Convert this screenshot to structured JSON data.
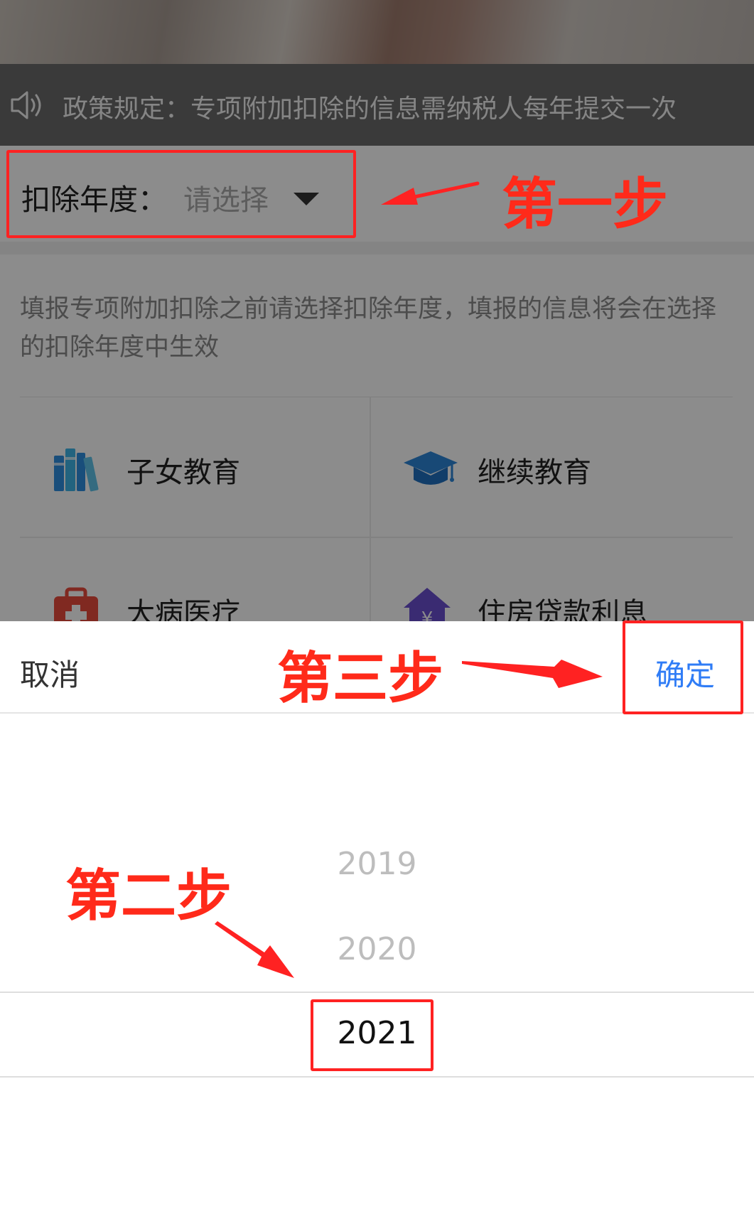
{
  "notice": {
    "text": "政策规定：专项附加扣除的信息需纳税人每年提交一次",
    "icon": "speaker-icon"
  },
  "year_select": {
    "label": "扣除年度：",
    "placeholder": "请选择"
  },
  "description": "填报专项附加扣除之前请选择扣除年度，填报的信息将会在选择的扣除年度中生效",
  "categories": [
    {
      "label": "子女教育",
      "icon": "books-icon",
      "color": "#3a8ee6"
    },
    {
      "label": "继续教育",
      "icon": "graduation-cap-icon",
      "color": "#2c86d8"
    },
    {
      "label": "大病医疗",
      "icon": "medical-kit-icon",
      "color": "#e94b3c"
    },
    {
      "label": "住房贷款利息",
      "icon": "house-yuan-icon",
      "color": "#6b4fd0"
    }
  ],
  "picker": {
    "cancel_label": "取消",
    "confirm_label": "确定",
    "confirm_color": "#2f7cf6",
    "years": [
      "2019",
      "2020",
      "2021"
    ],
    "selected": "2021"
  },
  "annotations": {
    "step1": "第一步",
    "step2": "第二步",
    "step3": "第三步",
    "color": "#ff2222"
  }
}
